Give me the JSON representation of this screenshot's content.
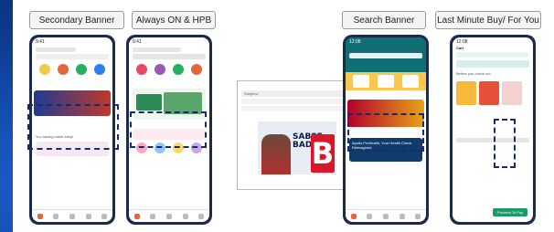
{
  "labels": {
    "secondary_banner": "Secondary Banner",
    "always_on_hpb": "Always ON & HPB",
    "search_banner": "Search Banner",
    "last_minute_buy": "Last Minute Buy/ For You"
  },
  "phone1": {
    "time": "9:41",
    "section_title": "You saving made easy!"
  },
  "phone2": {
    "time": "9:41"
  },
  "desktop": {
    "search_placeholder": "Sanjeevi",
    "banner_text": "SABSE BADA",
    "banner_letter": "B"
  },
  "phone3": {
    "time": "12:08",
    "promo_title": "Apollo ProHealth, Your Health Check Reimagined"
  },
  "phone4": {
    "time": "12:08",
    "header_title": "Cart",
    "section_title": "Before you check out",
    "cta_label": "Proceed To Pay"
  },
  "colors": {
    "accent_orange": "#e2683c",
    "teal": "#0f6f73",
    "green_cta": "#1c9a6a",
    "dash_navy": "#1b2a6b",
    "background_blue": "#0b3a8f"
  }
}
